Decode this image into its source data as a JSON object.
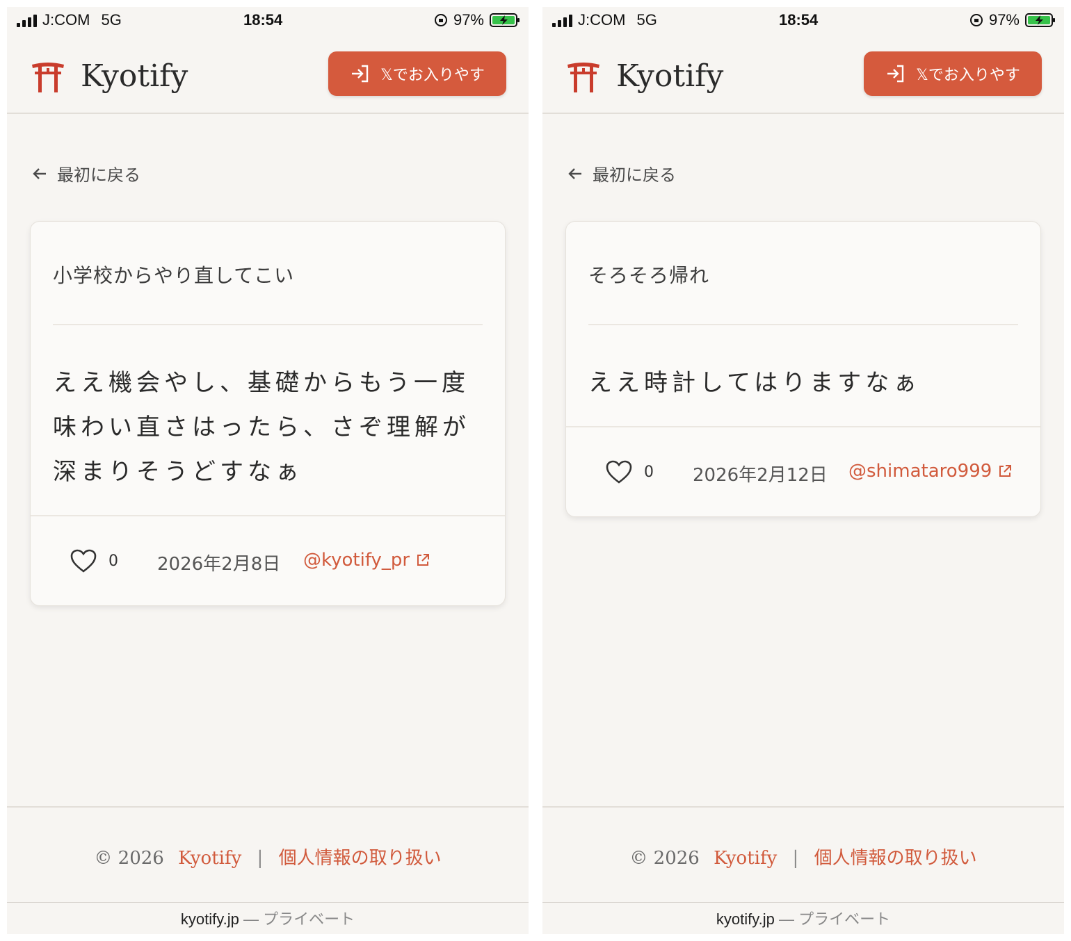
{
  "status_bar": {
    "carrier": "J:COM",
    "network": "5G",
    "time": "18:54",
    "battery_percent": "97%"
  },
  "header": {
    "brand": "Kyotify",
    "login_label": "𝕏でお入りやす"
  },
  "back_label": "最初に戻る",
  "screens": [
    {
      "prompt": "小学校からやり直してこい",
      "answer": "ええ機会やし、基礎からもう一度味わい直さはったら、さぞ理解が深まりそうどすなぁ",
      "likes": "0",
      "date": "2026年2月8日",
      "user": "@kyotify_pr"
    },
    {
      "prompt": "そろそろ帰れ",
      "answer": "ええ時計してはりますなぁ",
      "likes": "0",
      "date": "2026年2月12日",
      "user": "@shimataro999"
    }
  ],
  "footer": {
    "copyright": "© 2026",
    "brand": "Kyotify",
    "separator": "|",
    "privacy": "個人情報の取り扱い"
  },
  "url_bar": {
    "domain": "kyotify.jp",
    "mode": "— プライベート"
  },
  "colors": {
    "accent": "#d55a3d",
    "background": "#f7f5f2",
    "card": "#fbfaf8"
  }
}
